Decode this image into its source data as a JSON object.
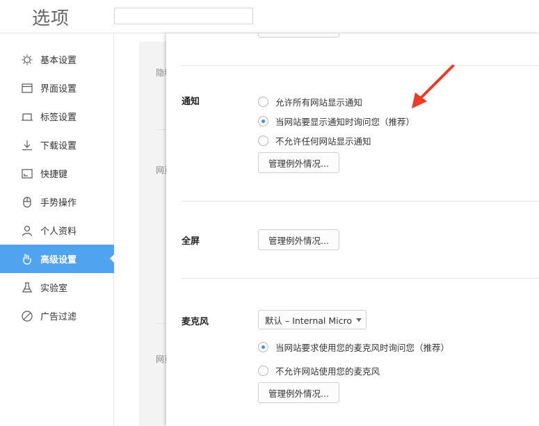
{
  "header": {
    "title": "选项",
    "search_value": ""
  },
  "sidebar": {
    "items": [
      {
        "label": "基本设置",
        "icon": "gear-icon"
      },
      {
        "label": "界面设置",
        "icon": "window-icon"
      },
      {
        "label": "标签设置",
        "icon": "tab-icon"
      },
      {
        "label": "下载设置",
        "icon": "download-icon"
      },
      {
        "label": "快捷键",
        "icon": "keyboard-icon"
      },
      {
        "label": "手势操作",
        "icon": "mouse-icon"
      },
      {
        "label": "个人资料",
        "icon": "user-icon"
      },
      {
        "label": "高级设置",
        "icon": "wrench-hand-icon",
        "active": true
      },
      {
        "label": "实验室",
        "icon": "flask-icon"
      },
      {
        "label": "广告过滤",
        "icon": "block-icon"
      }
    ],
    "active_color": "#4fa3ef"
  },
  "background": {
    "label1": "隐私",
    "label2": "网页",
    "label3": "网页"
  },
  "notification": {
    "label": "通知",
    "options": [
      {
        "label": "允许所有网站显示通知",
        "checked": false
      },
      {
        "label": "当网站要显示通知时询问您（推荐）",
        "checked": true
      },
      {
        "label": "不允许任何网站显示通知",
        "checked": false
      }
    ],
    "manage_label": "管理例外情况..."
  },
  "fullscreen": {
    "label": "全屏",
    "manage_label": "管理例外情况..."
  },
  "microphone": {
    "label": "麦克风",
    "select_value": "默认 – Internal Micro",
    "options": [
      {
        "label": "当网站要求使用您的麦克风时询问您（推荐）",
        "checked": true
      },
      {
        "label": "不允许网站使用您的麦克风",
        "checked": false
      }
    ],
    "manage_label": "管理例外情况..."
  },
  "annotation": {
    "arrow_color": "#f03a25"
  }
}
